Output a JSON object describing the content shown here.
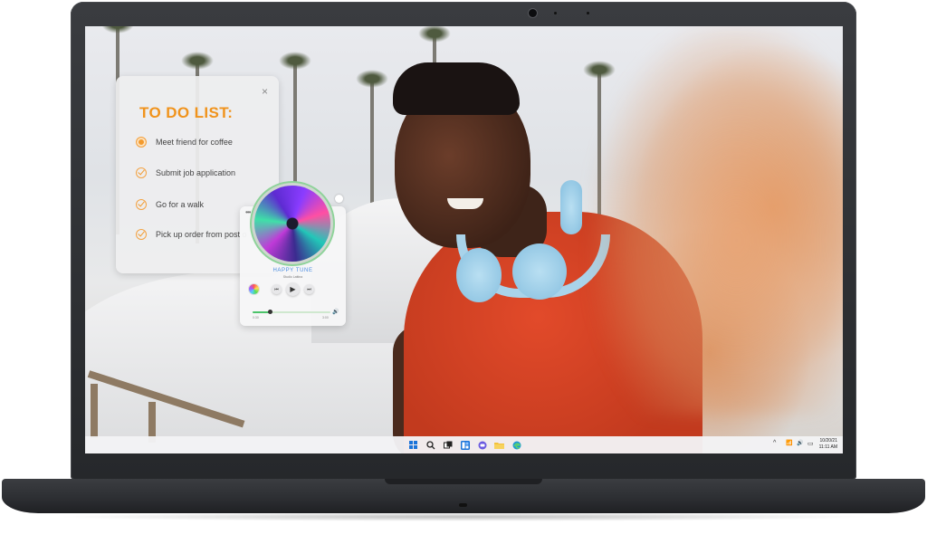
{
  "todo": {
    "title": "TO DO LIST:",
    "close": "×",
    "items": [
      {
        "label": "Meet friend for coffee",
        "state": "active"
      },
      {
        "label": "Submit job application",
        "state": "done"
      },
      {
        "label": "Go for a walk",
        "state": "done"
      },
      {
        "label": "Pick up order from post o",
        "state": "done"
      }
    ]
  },
  "music": {
    "menu": "•••",
    "title": "HAPPY TUNE",
    "artist": "Studio Lattina",
    "progress_percent": 22,
    "time_elapsed": "0:30",
    "time_total": "3:00",
    "controls": {
      "prev": "⏮",
      "play": "▶",
      "next": "⏭",
      "volume": "🔊"
    }
  },
  "taskbar": {
    "icons": [
      "windows-start-icon",
      "search-icon",
      "task-view-icon",
      "widgets-icon",
      "chat-icon",
      "file-explorer-icon",
      "edge-browser-icon"
    ],
    "tray": {
      "chevron": "^",
      "wifi": "📶",
      "volume": "🔊",
      "battery": "▭"
    },
    "clock": {
      "date": "10/20/21",
      "time": "11:11 AM"
    }
  },
  "colors": {
    "accent_orange": "#f0931c",
    "music_blue": "#4b8de0",
    "progress_green": "#4cc36a",
    "windows_blue": "#1a73d9"
  }
}
